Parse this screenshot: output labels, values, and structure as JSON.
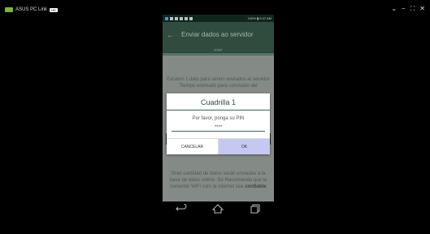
{
  "window": {
    "title": "ASUS PC Link",
    "badge": "HD",
    "controls": {
      "menu": "⌄",
      "minimize": "−",
      "restore": "⛶",
      "close": "✕"
    }
  },
  "phone": {
    "status": {
      "right": "100% ▮ 9:47 AM"
    },
    "appbar": {
      "back": "←",
      "title": "Enviar dados ao servidor"
    },
    "tab": "STEP",
    "message_top": "Existem 1 dato para serem enviados al servidor Tiempo estimado para concluido del",
    "message_bottom_a": "Gran cantidad de datos serán enviadas a la base de datos online. Se Recomienda que la conexión WiFi com la internet sea ",
    "message_bottom_b": "confiable",
    "dialog": {
      "title": "Cuadrilla 1",
      "message": "Por favor, ponga su PIN",
      "pin_value": "****",
      "cancel": "CANCELAR",
      "ok": "OK"
    },
    "nav": {
      "back": "back-icon",
      "home": "home-icon",
      "recents": "recents-icon"
    }
  },
  "colors": {
    "appbar": "#2f4c3e",
    "dim_bg": "#848b86",
    "ok_bg": "#c5c8f0"
  }
}
